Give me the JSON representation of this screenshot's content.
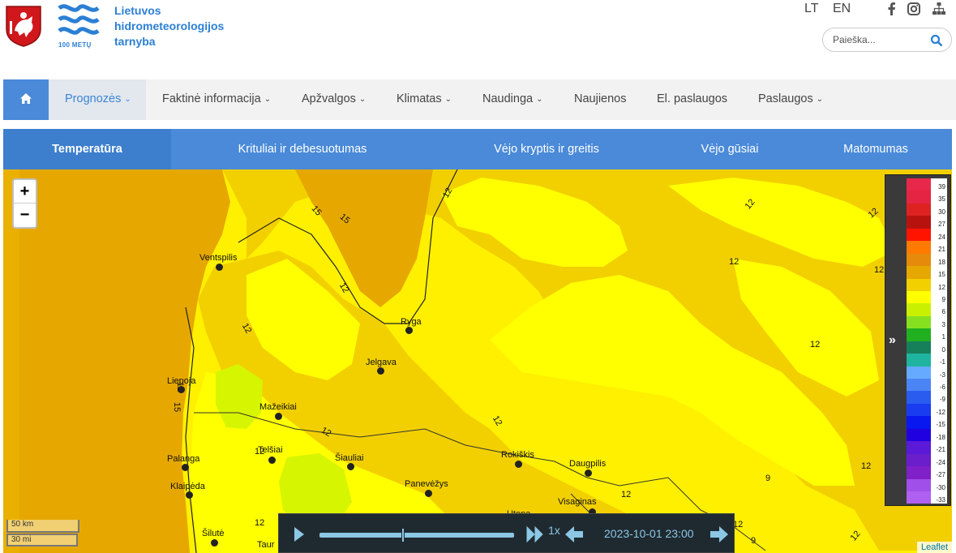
{
  "header": {
    "org_name_line1": "Lietuvos",
    "org_name_line2": "hidrometeorologijos",
    "org_name_line3": "tarnyba",
    "logo_sub": "100 METŲ",
    "languages": [
      "LT",
      "EN"
    ],
    "search_placeholder": "Paieška..."
  },
  "nav": {
    "items": [
      {
        "label": "Prognozės",
        "dropdown": true,
        "active": true
      },
      {
        "label": "Faktinė informacija",
        "dropdown": true
      },
      {
        "label": "Apžvalgos",
        "dropdown": true
      },
      {
        "label": "Klimatas",
        "dropdown": true
      },
      {
        "label": "Naudinga",
        "dropdown": true
      },
      {
        "label": "Naujienos",
        "dropdown": false
      },
      {
        "label": "El. paslaugos",
        "dropdown": false
      },
      {
        "label": "Paslaugos",
        "dropdown": true
      }
    ]
  },
  "tabs": [
    "Temperatūra",
    "Krituliai ir debesuotumas",
    "Vėjo kryptis ir greitis",
    "Vėjo gūsiai",
    "Matomumas"
  ],
  "map": {
    "zoom_in": "+",
    "zoom_out": "−",
    "cities": [
      "Ventspilis",
      "Ryga",
      "Jelgava",
      "Liepoja",
      "Mažeikiai",
      "Telšiai",
      "Šiauliai",
      "Palanga",
      "Klaipėda",
      "Panevėžys",
      "Rokiškis",
      "Daugpilis",
      "Visaginas",
      "Šilutė",
      "Utena",
      "Taur"
    ],
    "isoline_labels": [
      "15",
      "15",
      "12",
      "12",
      "12",
      "12",
      "12",
      "12",
      "12",
      "12",
      "15",
      "12",
      "12",
      "12",
      "12",
      "12",
      "12",
      "9",
      "9",
      "12",
      "12",
      "12"
    ],
    "scale": {
      "km": "50 km",
      "mi": "30 mi"
    },
    "attribution": "Leaflet"
  },
  "legend": {
    "toggle": "»",
    "entries": [
      {
        "value": "39",
        "color": "#e8284a"
      },
      {
        "value": "35",
        "color": "#e52444"
      },
      {
        "value": "30",
        "color": "#de2222"
      },
      {
        "value": "27",
        "color": "#b8120f"
      },
      {
        "value": "24",
        "color": "#ff1400"
      },
      {
        "value": "21",
        "color": "#ff7a00"
      },
      {
        "value": "18",
        "color": "#e58a0a"
      },
      {
        "value": "15",
        "color": "#e6a800"
      },
      {
        "value": "12",
        "color": "#f2d000"
      },
      {
        "value": "9",
        "color": "#ffff00"
      },
      {
        "value": "6",
        "color": "#c8f000"
      },
      {
        "value": "3",
        "color": "#86e020"
      },
      {
        "value": "1",
        "color": "#20b020"
      },
      {
        "value": "0",
        "color": "#16805a"
      },
      {
        "value": "-1",
        "color": "#1eb4a0"
      },
      {
        "value": "-3",
        "color": "#66aaff"
      },
      {
        "value": "-6",
        "color": "#4b84f5"
      },
      {
        "value": "-9",
        "color": "#2a5cf0"
      },
      {
        "value": "-12",
        "color": "#1a3cf0"
      },
      {
        "value": "-15",
        "color": "#0a18f0"
      },
      {
        "value": "-18",
        "color": "#2000e0"
      },
      {
        "value": "-21",
        "color": "#5a1ad8"
      },
      {
        "value": "-24",
        "color": "#6a1ecc"
      },
      {
        "value": "-27",
        "color": "#8020c8"
      },
      {
        "value": "-30",
        "color": "#a050e8"
      },
      {
        "value": "-33",
        "color": "#b060f0"
      }
    ]
  },
  "player": {
    "speed": "1x",
    "datetime": "2023-10-01 23:00",
    "progress": 0.43
  },
  "colors": {
    "accent": "#4a8ad8",
    "map_warm": "#e6a800",
    "map_mid": "#f2d000",
    "map_cool": "#ffff00"
  }
}
